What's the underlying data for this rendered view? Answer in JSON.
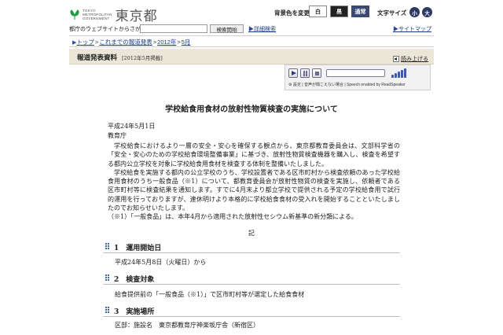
{
  "header": {
    "logo_small": [
      "TOKYO",
      "METROPOLITAN",
      "GOVERNMENT"
    ],
    "logo_big": "東京都",
    "color_label": "背景色を変更",
    "color_options": [
      "白",
      "黒",
      "通常"
    ],
    "font_size_label": "文字サイズ",
    "font_size_options": [
      "小",
      "大"
    ]
  },
  "search": {
    "label": "都庁のウェブサイトからさがす",
    "placeholder": "",
    "button": "検索開始",
    "advanced_link": "詳細検索",
    "sitemap_link": "サイトマップ"
  },
  "breadcrumb": [
    "トップ",
    "これまでの報道発表",
    "2012年",
    "5月"
  ],
  "title_bar": {
    "main": "報道発表資料",
    "sub": "[2012年5月掲載]"
  },
  "readspeaker": {
    "link": "読み上げる",
    "footer": "設定 | 音声が聞こえない場合 | Speech enabled by ReadSpeaker",
    "colors": {
      "frame": "#6a6a8a",
      "active": "#2a3a8a",
      "volume": "#3a5ab0"
    }
  },
  "article": {
    "title": "学校給食用食材の放射性物質検査の実施について",
    "date": "平成24年5月1日",
    "issuer": "教育庁",
    "paragraphs": [
      "学校給食におけるより一層の安全・安心を確保する観点から、東京都教育委員会は、文部科学省の「安全・安心のための学校給食環境整備事業」に基づき、放射性物質検査機器を購入し、検査を希望する都内公立学校を対象に学校給食用食材を検査する体制を整備いたしました。",
      "学校給食を実施する都内の公立学校のうち、学校設置者である区市町村から検査依頼のあった学校給食用食材のうち一般食品（※1）について、都教育委員会が放射性物質の検査を実施し、依頼者である区市町村等に検査結果を通知します。すでに4月末より都立学校で提供される予定の学校給食用で試行的運用を行っておりますが、連休明けより本格的に学校給食食材の受入れを開始することといたしましたのでお知らせいたします。"
    ],
    "note": "（※1）「一般食品」は、本年4月から適用された放射性セシウム新基準の新分類による。",
    "ki": "記"
  },
  "sections": [
    {
      "number": "1",
      "title": "運用開始日",
      "text": "平成24年5月8日（火曜日）から"
    },
    {
      "number": "2",
      "title": "検査対象",
      "text": "給食提供前の「一般食品（※1）」で区市町村等が選定した給食食材"
    },
    {
      "number": "3",
      "title": "実施場所",
      "text": "区部：施設名　東京都教育庁神楽坂庁舎（新宿区）"
    }
  ],
  "colors": {
    "link": "#1a3a8a",
    "title_bar_bg": "#ebe6d8",
    "section_mark": "#3a6aa0",
    "logo_green": "#1e9a46",
    "normal_btn": "#3a4a72"
  }
}
